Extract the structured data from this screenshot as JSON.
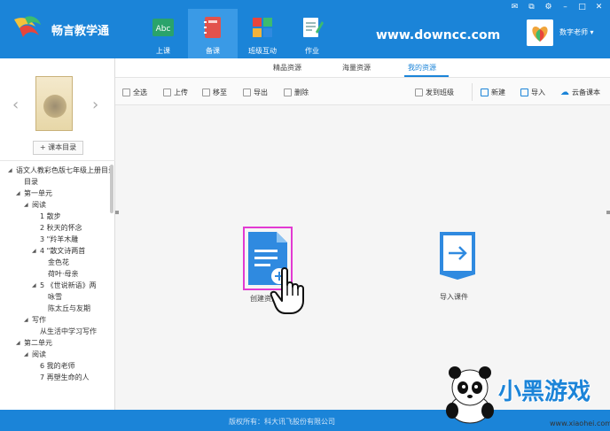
{
  "app": {
    "logo_text": "畅言教学通"
  },
  "nav": [
    {
      "label": "上课",
      "icon": "abc-book-icon",
      "color": "#2aa36b"
    },
    {
      "label": "备课",
      "icon": "notebook-icon",
      "color": "#e2524c"
    },
    {
      "label": "班级互动",
      "icon": "grid-apps-icon",
      "color": "#f1b23a"
    },
    {
      "label": "作业",
      "icon": "edit-doc-icon",
      "color": "#3dbb6f"
    }
  ],
  "watermark_url": "www.downcc.com",
  "window_controls": [
    "mail-icon",
    "restore-icon",
    "settings-icon",
    "minimize-icon",
    "maximize-icon",
    "close-icon"
  ],
  "user": {
    "name": "数字老师"
  },
  "left": {
    "toc_button": "+ 课本目录",
    "tree": [
      {
        "label": "语文人教彩色版七年级上册目录",
        "level": 0,
        "expanded": true
      },
      {
        "label": "目录",
        "level": 1
      },
      {
        "label": "第一单元",
        "level": 1,
        "expanded": true
      },
      {
        "label": "阅读",
        "level": 2,
        "expanded": true
      },
      {
        "label": "1 散步",
        "level": 3
      },
      {
        "label": "2 秋天的怀念",
        "level": 3
      },
      {
        "label": "3 \"羚羊木雕",
        "level": 3
      },
      {
        "label": "4 \"散文诗两首",
        "level": 3,
        "expanded": true
      },
      {
        "label": "金色花",
        "level": 4
      },
      {
        "label": "荷叶·母亲",
        "level": 4
      },
      {
        "label": "5 《世说新语》两",
        "level": 3,
        "expanded": true
      },
      {
        "label": "咏雪",
        "level": 4
      },
      {
        "label": "陈太丘与友期",
        "level": 4
      },
      {
        "label": "写作",
        "level": 2,
        "expanded": true
      },
      {
        "label": "从生活中学习写作",
        "level": 3
      },
      {
        "label": "第二单元",
        "level": 1,
        "expanded": true
      },
      {
        "label": "阅读",
        "level": 2,
        "expanded": true
      },
      {
        "label": "6 我的老师",
        "level": 3
      },
      {
        "label": "7 再塑生命的人",
        "level": 3
      }
    ]
  },
  "subtabs": [
    {
      "label": "精品资源",
      "active": false
    },
    {
      "label": "海量资源",
      "active": false
    },
    {
      "label": "我的资源",
      "active": true
    }
  ],
  "toolbar": {
    "select_all": "全选",
    "upload": "上传",
    "move_to": "移至",
    "export": "导出",
    "delete": "删除",
    "send_to_class": "发到班级",
    "new": "新建",
    "import": "导入",
    "cloud": "云备课本"
  },
  "cards": {
    "create": "创建资源",
    "import": "导入课件"
  },
  "footer": "版权所有：科大讯飞股份有限公司",
  "watermark": {
    "brand": "小黑游戏",
    "url": "www.xiaohei.com"
  },
  "colors": {
    "primary": "#1b84d8",
    "highlight": "#e23ad2"
  }
}
